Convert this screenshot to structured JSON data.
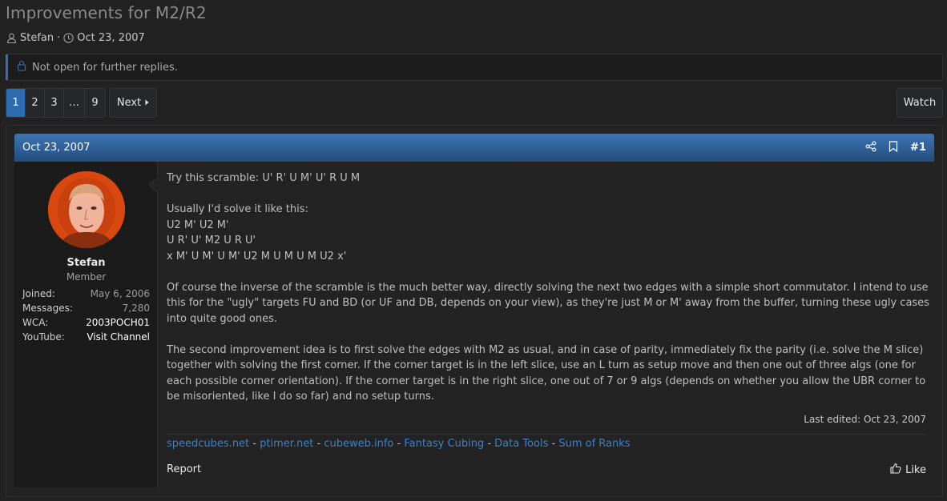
{
  "thread": {
    "title": "Improvements for M2/R2",
    "author": "Stefan",
    "date": "Oct 23, 2007"
  },
  "notice": {
    "text": "Not open for further replies."
  },
  "pagination": {
    "pages": [
      "1",
      "2",
      "3",
      "…",
      "9"
    ],
    "current": "1",
    "next_label": "Next"
  },
  "watch_label": "Watch",
  "post": {
    "date": "Oct 23, 2007",
    "number": "#1",
    "user": {
      "name": "Stefan",
      "title": "Member",
      "stats": [
        {
          "label": "Joined:",
          "value": "May 6, 2006"
        },
        {
          "label": "Messages:",
          "value": "7,280"
        },
        {
          "label": "WCA:",
          "value": "2003POCH01"
        },
        {
          "label": "YouTube:",
          "value": "Visit Channel"
        }
      ]
    },
    "body": {
      "scramble_line": "Try this scramble: U' R' U M' U' R U M",
      "solve_intro": "Usually I'd solve it like this:",
      "solve_lines": [
        "U2 M' U2 M'",
        "U R' U' M2 U R U'",
        "x M' U M' U M' U2 M U M U M U2 x'"
      ],
      "para1": "Of course the inverse of the scramble is the much better way, directly solving the next two edges with a simple short commutator. I intend to use this for the \"ugly\" targets FU and BD (or UF and DB, depends on your view), as they're just M or M' away from the buffer, turning these ugly cases into quite good ones.",
      "para2": "The second improvement idea is to first solve the edges with M2 as usual, and in case of parity, immediately fix the parity (i.e. solve the M slice) together with solving the first corner. If the corner target is in the left slice, use an L turn as setup move and then one out of three algs (one for each possible corner orientation). If the corner target is in the right slice, one out of 7 or 9 algs (depends on whether you allow the UBR corner to be misoriented, like I do so far) and no setup turns."
    },
    "last_edited": "Last edited: Oct 23, 2007",
    "signature": {
      "links": [
        "speedcubes.net",
        "ptimer.net",
        "cubeweb.info",
        "Fantasy Cubing",
        "Data Tools",
        "Sum of Ranks"
      ],
      "separator": " - "
    },
    "report_label": "Report",
    "like_label": "Like"
  },
  "colors": {
    "background": "#222223",
    "accent": "#2d6bb0",
    "header_gradient_top": "#3c75b3",
    "header_gradient_bottom": "#244d7e",
    "link": "#3f80c7"
  }
}
